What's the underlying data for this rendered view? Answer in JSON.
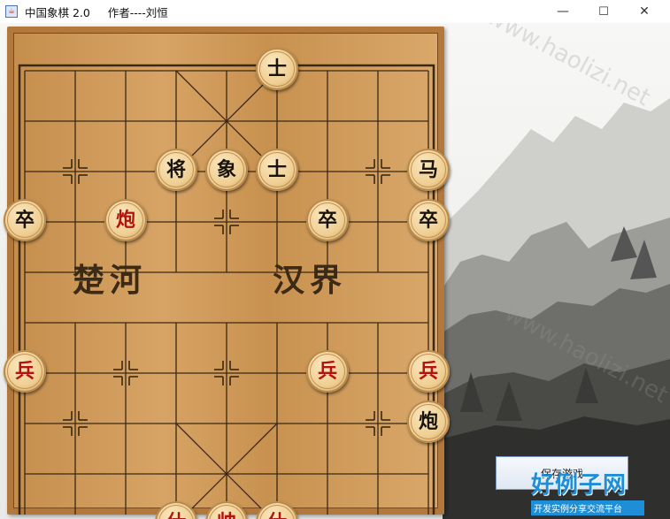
{
  "window": {
    "title": "中国象棋 2.0     作者----刘恒",
    "app_icon": "java-app-icon",
    "controls": {
      "minimize": "—",
      "maximize": "☐",
      "close": "✕"
    }
  },
  "board": {
    "river_left": "楚河",
    "river_right": "汉界"
  },
  "pieces": [
    {
      "label": "士",
      "side": "black",
      "file": 5,
      "rank": 0
    },
    {
      "label": "将",
      "side": "black",
      "file": 3,
      "rank": 2
    },
    {
      "label": "象",
      "side": "black",
      "file": 4,
      "rank": 2
    },
    {
      "label": "士",
      "side": "black",
      "file": 5,
      "rank": 2
    },
    {
      "label": "马",
      "side": "black",
      "file": 8,
      "rank": 2
    },
    {
      "label": "卒",
      "side": "black",
      "file": 0,
      "rank": 3
    },
    {
      "label": "炮",
      "side": "red",
      "file": 2,
      "rank": 3
    },
    {
      "label": "卒",
      "side": "black",
      "file": 6,
      "rank": 3
    },
    {
      "label": "卒",
      "side": "black",
      "file": 8,
      "rank": 3
    },
    {
      "label": "兵",
      "side": "red",
      "file": 0,
      "rank": 6
    },
    {
      "label": "兵",
      "side": "red",
      "file": 6,
      "rank": 6
    },
    {
      "label": "兵",
      "side": "red",
      "file": 8,
      "rank": 6
    },
    {
      "label": "炮",
      "side": "black",
      "file": 8,
      "rank": 7
    },
    {
      "label": "仕",
      "side": "red",
      "file": 3,
      "rank": 9
    },
    {
      "label": "帅",
      "side": "red",
      "file": 4,
      "rank": 9
    },
    {
      "label": "仕",
      "side": "red",
      "file": 5,
      "rank": 9
    }
  ],
  "save_button": {
    "label": "保存游戏"
  },
  "watermark": {
    "text": "www.haolizi.net"
  },
  "logo": {
    "main": "好例子网",
    "sub": "开发实例分享交流平台"
  },
  "colors": {
    "red_piece": "#b3140f",
    "black_piece": "#1a1410",
    "board": "#d1a061",
    "logo": "#1e8fd6"
  }
}
